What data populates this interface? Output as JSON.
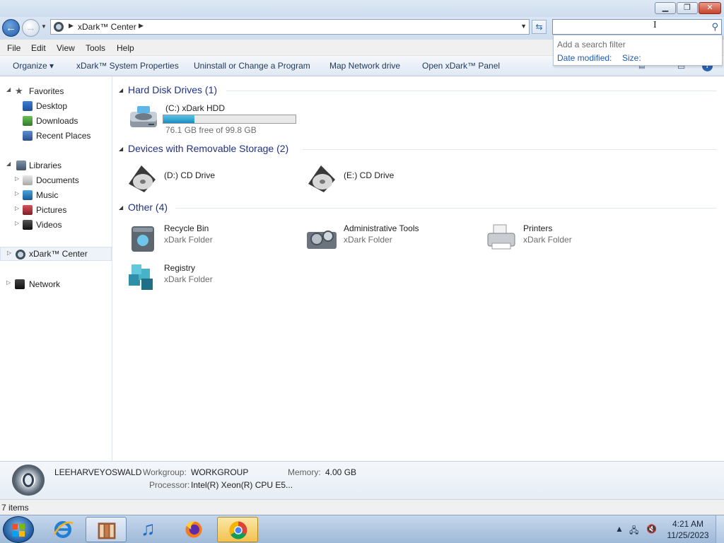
{
  "address": {
    "path_label": "xDark™ Center"
  },
  "menu": {
    "items": [
      "File",
      "Edit",
      "View",
      "Tools",
      "Help"
    ]
  },
  "command_bar": {
    "organize": "Organize ▾",
    "system_properties": "xDark™ System Properties",
    "uninstall": "Uninstall or Change a Program",
    "map_drive": "Map Network drive",
    "open_panel": "Open xDark™ Panel"
  },
  "search": {
    "dropdown_hint": "Add a search filter",
    "filter_date": "Date modified:",
    "filter_size": "Size:"
  },
  "nav": {
    "favorites": "Favorites",
    "desktop": "Desktop",
    "downloads": "Downloads",
    "recent": "Recent Places",
    "libraries": "Libraries",
    "documents": "Documents",
    "music": "Music",
    "pictures": "Pictures",
    "videos": "Videos",
    "center": "xDark™ Center",
    "network": "Network"
  },
  "groups": {
    "hdd": {
      "title": "Hard Disk Drives (1)",
      "drive_name": "(C:) xDark HDD",
      "free_text": "76.1 GB free of 99.8 GB",
      "used_fraction": 0.237
    },
    "removable": {
      "title": "Devices with Removable Storage (2)",
      "d_drive": "(D:) CD Drive",
      "e_drive": "(E:) CD Drive"
    },
    "other": {
      "title": "Other (4)",
      "recycle_name": "Recycle Bin",
      "recycle_sub": "xDark Folder",
      "admin_name": "Administrative Tools",
      "admin_sub": "xDark Folder",
      "printers_name": "Printers",
      "printers_sub": "xDark Folder",
      "registry_name": "Registry",
      "registry_sub": "xDark Folder"
    }
  },
  "details": {
    "computer_name": "LEEHARVEYOSWALD",
    "workgroup_label": "Workgroup:",
    "workgroup_value": "WORKGROUP",
    "memory_label": "Memory:",
    "memory_value": "4.00 GB",
    "processor_label": "Processor:",
    "processor_value": "Intel(R) Xeon(R) CPU E5..."
  },
  "status": {
    "items_count": "7 items"
  },
  "taskbar": {
    "time": "4:21 AM",
    "date": "11/25/2023"
  },
  "colors": {
    "group_title": "#1e3287",
    "link_blue": "#1a5bb4",
    "progress_fill": "#1a8ec0"
  }
}
